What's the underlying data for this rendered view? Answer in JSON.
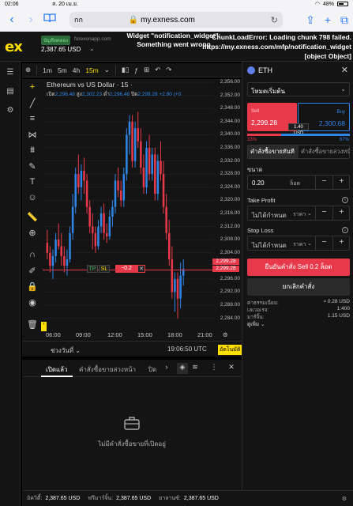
{
  "status_bar": {
    "time": "02:06",
    "date": "ส. 20 เม.ย.",
    "battery": "48%"
  },
  "browser": {
    "aa": "กก",
    "url": "my.exness.com",
    "reload": "↻"
  },
  "header": {
    "account_badge": "บัญชีทดลอง",
    "site": "forexonapp.com",
    "balance": "2,387.65",
    "currency": "USD",
    "widget_error": "Widget \"notification_widget\": Something went wrong",
    "chunk_error": "ChunkLoadError: Loading chunk 798 failed. https://my.exness.com/mfp/notification_widget [object Object]"
  },
  "chart_toolbar": {
    "timeframes": [
      "1m",
      "5m",
      "4h",
      "15m"
    ],
    "selected": "15m"
  },
  "chart_legend": {
    "title": "Ethereum vs US Dollar · 15 ·",
    "open_label": "เปิด",
    "open": "2,296.48",
    "high_label": "สูง",
    "high": "2,302.23",
    "low_label": "ต่ำ",
    "low": "2,296.48",
    "close_label": "ปิด",
    "close": "2,299.28",
    "change": "+2.80 (+0"
  },
  "chart_data": {
    "type": "candlestick",
    "title": "Ethereum vs US Dollar · 15 ·",
    "x_ticks": [
      "06:00",
      "09:00",
      "12:00",
      "15:00",
      "18:00",
      "21:00"
    ],
    "y_ticks": [
      2356.0,
      2352.0,
      2348.0,
      2344.0,
      2340.0,
      2336.0,
      2332.0,
      2328.0,
      2324.0,
      2320.0,
      2316.0,
      2312.0,
      2308.0,
      2304.0,
      2296.0,
      2292.0,
      2288.0,
      2284.0
    ],
    "ylim": [
      2281,
      2357
    ],
    "price_labels": [
      "2,299.28",
      "2,299.28"
    ],
    "candles_ohlc": [
      [
        2307,
        2311,
        2302,
        2304
      ],
      [
        2304,
        2306,
        2298,
        2300
      ],
      [
        2300,
        2305,
        2296,
        2303
      ],
      [
        2303,
        2310,
        2301,
        2308
      ],
      [
        2308,
        2313,
        2305,
        2306
      ],
      [
        2306,
        2310,
        2300,
        2303
      ],
      [
        2303,
        2306,
        2298,
        2300
      ],
      [
        2300,
        2305,
        2297,
        2302
      ],
      [
        2302,
        2312,
        2301,
        2310
      ],
      [
        2310,
        2322,
        2308,
        2318
      ],
      [
        2318,
        2330,
        2316,
        2328
      ],
      [
        2328,
        2334,
        2322,
        2324
      ],
      [
        2324,
        2331,
        2320,
        2329
      ],
      [
        2329,
        2333,
        2322,
        2326
      ],
      [
        2326,
        2328,
        2316,
        2318
      ],
      [
        2318,
        2320,
        2310,
        2312
      ],
      [
        2312,
        2316,
        2305,
        2310
      ],
      [
        2310,
        2312,
        2304,
        2306
      ],
      [
        2306,
        2314,
        2305,
        2312
      ],
      [
        2312,
        2318,
        2310,
        2316
      ],
      [
        2316,
        2319,
        2308,
        2310
      ],
      [
        2310,
        2313,
        2307,
        2309
      ],
      [
        2309,
        2317,
        2308,
        2315
      ],
      [
        2315,
        2320,
        2312,
        2318
      ],
      [
        2318,
        2328,
        2316,
        2326
      ],
      [
        2326,
        2330,
        2321,
        2323
      ],
      [
        2323,
        2326,
        2318,
        2320
      ],
      [
        2320,
        2330,
        2318,
        2328
      ],
      [
        2328,
        2342,
        2326,
        2340
      ],
      [
        2340,
        2346,
        2334,
        2344
      ],
      [
        2344,
        2346,
        2330,
        2332
      ],
      [
        2332,
        2344,
        2330,
        2342
      ],
      [
        2342,
        2347,
        2336,
        2338
      ],
      [
        2338,
        2342,
        2328,
        2330
      ],
      [
        2330,
        2334,
        2322,
        2324
      ],
      [
        2324,
        2338,
        2322,
        2336
      ],
      [
        2336,
        2340,
        2326,
        2328
      ],
      [
        2328,
        2336,
        2326,
        2334
      ],
      [
        2334,
        2336,
        2320,
        2322
      ],
      [
        2322,
        2334,
        2320,
        2332
      ],
      [
        2332,
        2338,
        2326,
        2328
      ],
      [
        2328,
        2332,
        2316,
        2318
      ],
      [
        2318,
        2322,
        2308,
        2310
      ],
      [
        2310,
        2314,
        2300,
        2302
      ],
      [
        2302,
        2306,
        2290,
        2292
      ],
      [
        2292,
        2298,
        2286,
        2296
      ],
      [
        2296,
        2298,
        2284,
        2290
      ],
      [
        2290,
        2301,
        2287,
        2297
      ],
      [
        2297,
        2302,
        2294,
        2299
      ]
    ]
  },
  "order_overlay": {
    "tp": "TP",
    "sl": "SL",
    "pnl": "−0.2",
    "close": "✕"
  },
  "range_bar": {
    "range_label": "ช่วงวันที่",
    "time": "19:06:50 UTC",
    "auto": "อัตโนมัติ"
  },
  "bottom_panel": {
    "tabs": [
      "เปิดแล้ว",
      "คำสั่งซื้อขายล่วงหน้า",
      "ปิด"
    ],
    "empty_text": "ไม่มีคำสั่งซื้อขายที่เปิดอยู่"
  },
  "footer": [
    {
      "label": "อิควิตี้:",
      "value": "2,387.65 USD"
    },
    {
      "label": "ฟรีมาร์จิ้น:",
      "value": "2,387.65 USD"
    },
    {
      "label": "ยาลานซ์:",
      "value": "2,387.65 USD"
    }
  ],
  "order_panel": {
    "symbol": "ETH",
    "order_type": "โหมดเริ่มต้น",
    "sell_label": "Sell",
    "sell_price": "2,299.28",
    "buy_label": "Buy",
    "buy_price": "2,300.68",
    "spread": "1.40 USD",
    "sentiment_sell": "33%",
    "sentiment_buy": "67%",
    "sentiment_sell_fraction": 0.33,
    "mode_tab_1": "คำสั่งซื้อขายทันที",
    "mode_tab_2": "คำสั่งซื้อขายล่วงหน้า",
    "volume_label": "ขนาด",
    "volume": "0.20",
    "volume_unit": "ล็อต",
    "tp_label": "Take Profit",
    "tp_value": "ไม่ได้กำหนด",
    "tp_unit": "ราคา",
    "sl_label": "Stop Loss",
    "sl_value": "ไม่ได้กำหนด",
    "sl_unit": "ราคา",
    "confirm": "ยืนยันคำสั่ง Sell 0.2 ล็อต",
    "cancel": "ยกเลิกคำสั่ง",
    "info": [
      {
        "label": "ค่าธรรมเนียม:",
        "value": "≈ 0.28 USD"
      },
      {
        "label": "เลเวอเรจ:",
        "value": "1:400"
      },
      {
        "label": "มาร์จิ้น:",
        "value": "1.15 USD"
      },
      {
        "label": "ดูเพิ่ม",
        "value": ""
      }
    ]
  },
  "colors": {
    "up": "#2f86e8",
    "down": "#e7394a",
    "accent": "#ffde02",
    "bg": "#141414"
  }
}
